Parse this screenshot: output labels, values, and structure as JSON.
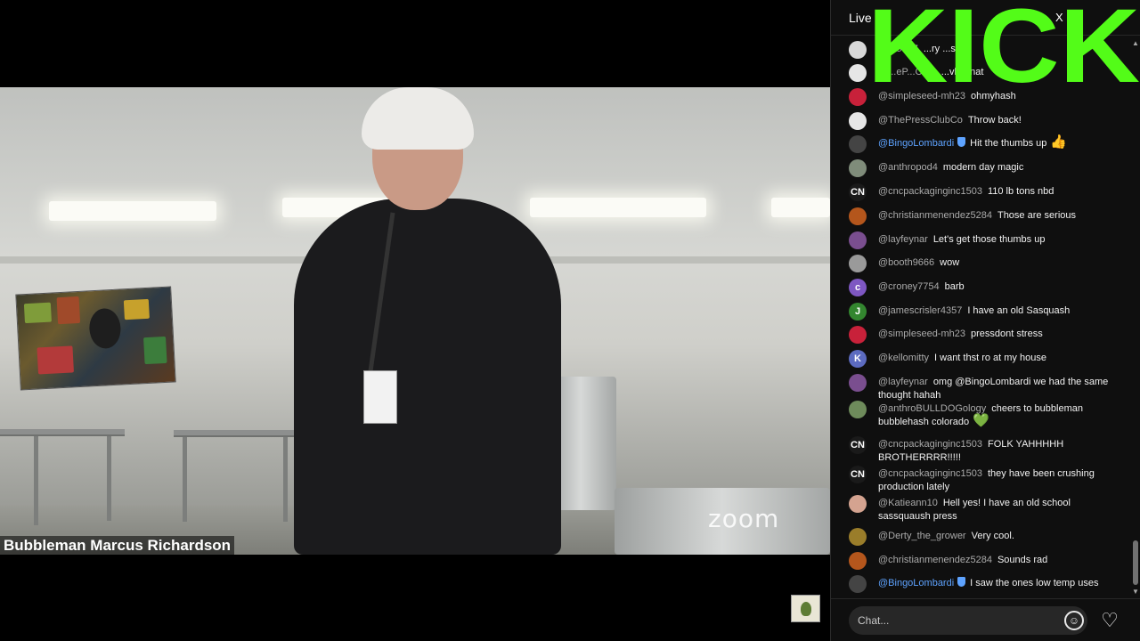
{
  "chat": {
    "header_label": "Live",
    "header_more": "X",
    "input_placeholder": "Chat...",
    "messages": [
      {
        "author": "@...5517",
        "text": "...ry ...s",
        "avatar_color": "#d8d8d8",
        "avatar_letter": ""
      },
      {
        "author": "@...eP...Co...",
        "text": "...vle...nat",
        "avatar_color": "#e6e6e6",
        "avatar_letter": ""
      },
      {
        "author": "@simpleseed-mh23",
        "text": "ohmyhash",
        "avatar_color": "#c8213a",
        "avatar_letter": ""
      },
      {
        "author": "@ThePressClubCo",
        "text": "Throw back!",
        "avatar_color": "#e6e6e6",
        "avatar_letter": ""
      },
      {
        "author": "@BingoLombardi",
        "text": "Hit the thumbs up",
        "avatar_color": "#444",
        "avatar_letter": "",
        "mod": true,
        "emoji": "👍"
      },
      {
        "author": "@anthropod4",
        "text": "modern day magic",
        "avatar_color": "#7f8c7a",
        "avatar_letter": ""
      },
      {
        "author": "@cncpackaginginc1503",
        "text": "110 lb tons nbd",
        "avatar_color": "#1a1a1a",
        "avatar_letter": "CN"
      },
      {
        "author": "@christianmenendez5284",
        "text": "Those are serious",
        "avatar_color": "#b4561c",
        "avatar_letter": ""
      },
      {
        "author": "@layfeynar",
        "text": "Let's get those thumbs up",
        "avatar_color": "#7a4e8f",
        "avatar_letter": ""
      },
      {
        "author": "@booth9666",
        "text": "wow",
        "avatar_color": "#9a9a9a",
        "avatar_letter": ""
      },
      {
        "author": "@croney7754",
        "text": "barb",
        "avatar_color": "#7e57c2",
        "avatar_letter": "c"
      },
      {
        "author": "@jamescrisler4357",
        "text": "I have an old Sasquash",
        "avatar_color": "#33862f",
        "avatar_letter": "J"
      },
      {
        "author": "@simpleseed-mh23",
        "text": "pressdont stress",
        "avatar_color": "#c8213a",
        "avatar_letter": ""
      },
      {
        "author": "@kellomitty",
        "text": "I want thst ro at my house",
        "avatar_color": "#5c6bc0",
        "avatar_letter": "K"
      },
      {
        "author": "@layfeynar",
        "text": "omg @BingoLombardi we had the same thought hahah",
        "avatar_color": "#7a4e8f",
        "avatar_letter": ""
      },
      {
        "author": "@anthroBULLDOGology",
        "text": "cheers to bubbleman bubblehash colorado",
        "avatar_color": "#6e8b5b",
        "avatar_letter": "",
        "emoji": "💚"
      },
      {
        "author": "@cncpackaginginc1503",
        "text": "FOLK YAHHHHH BROTHERRRR!!!!!",
        "avatar_color": "#1a1a1a",
        "avatar_letter": "CN"
      },
      {
        "author": "@cncpackaginginc1503",
        "text": "they have been crushing production lately",
        "avatar_color": "#1a1a1a",
        "avatar_letter": "CN"
      },
      {
        "author": "@Katieann10",
        "text": "Hell yes! I have an old school sassquaush press",
        "avatar_color": "#d4a390",
        "avatar_letter": ""
      },
      {
        "author": "@Derty_the_grower",
        "text": "Very cool.",
        "avatar_color": "#9a7d2a",
        "avatar_letter": ""
      },
      {
        "author": "@christianmenendez5284",
        "text": "Sounds rad",
        "avatar_color": "#b4561c",
        "avatar_letter": ""
      },
      {
        "author": "@BingoLombardi",
        "text": "I saw the ones low temp uses",
        "avatar_color": "#444",
        "avatar_letter": "",
        "mod": true
      }
    ]
  },
  "video": {
    "participant_name": "Bubbleman Marcus Richardson",
    "watermark": "zoom"
  },
  "overlay": {
    "brand": "KICK",
    "color": "#53fc18"
  }
}
